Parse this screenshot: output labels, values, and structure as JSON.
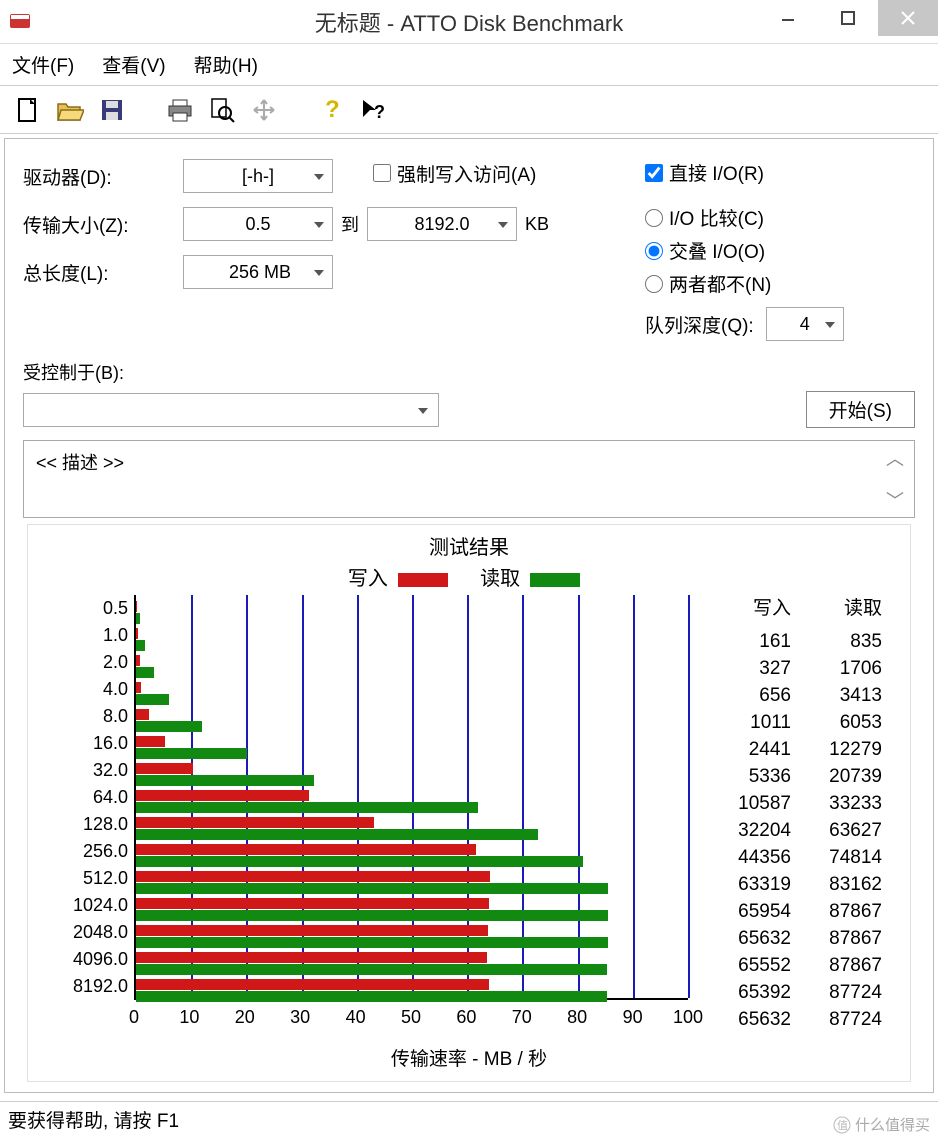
{
  "window": {
    "title": "无标题 - ATTO Disk Benchmark"
  },
  "menu": {
    "file": "文件(F)",
    "view": "查看(V)",
    "help": "帮助(H)"
  },
  "labels": {
    "drive": "驱动器(D):",
    "transfer_size": "传输大小(Z):",
    "to": "到",
    "kb": "KB",
    "total_len": "总长度(L):",
    "force_write": "强制写入访问(A)",
    "direct_io": "直接 I/O(R)",
    "io_compare": "I/O 比较(C)",
    "overlapped": "交叠 I/O(O)",
    "neither": "两者都不(N)",
    "queue_depth": "队列深度(Q):",
    "controlled_by": "受控制于(B):",
    "start": "开始(S)",
    "description": "<< 描述 >>",
    "results_title": "测试结果",
    "write": "写入",
    "read": "读取",
    "xlabel": "传输速率 - MB / 秒",
    "status": "要获得帮助, 请按 F1",
    "watermark": "什么值得买"
  },
  "values": {
    "drive": "[-h-]",
    "size_from": "0.5",
    "size_to": "8192.0",
    "total_len": "256 MB",
    "queue_depth": "4",
    "direct_io_checked": true,
    "radio_selected": "overlapped"
  },
  "chart_data": {
    "type": "bar",
    "title": "测试结果",
    "xlabel": "传输速率 - MB / 秒",
    "xlim": [
      0,
      100
    ],
    "xticks": [
      0,
      10,
      20,
      30,
      40,
      50,
      60,
      70,
      80,
      90,
      100
    ],
    "categories": [
      "0.5",
      "1.0",
      "2.0",
      "4.0",
      "8.0",
      "16.0",
      "32.0",
      "64.0",
      "128.0",
      "256.0",
      "512.0",
      "1024.0",
      "2048.0",
      "4096.0",
      "8192.0"
    ],
    "series": [
      {
        "name": "写入",
        "color": "#d01818",
        "values_kb_s": [
          161,
          327,
          656,
          1011,
          2441,
          5336,
          10587,
          32204,
          44356,
          63319,
          65954,
          65632,
          65552,
          65392,
          65632
        ]
      },
      {
        "name": "读取",
        "color": "#128a12",
        "values_kb_s": [
          835,
          1706,
          3413,
          6053,
          12279,
          20739,
          33233,
          63627,
          74814,
          83162,
          87867,
          87867,
          87867,
          87724,
          87724
        ]
      }
    ]
  }
}
